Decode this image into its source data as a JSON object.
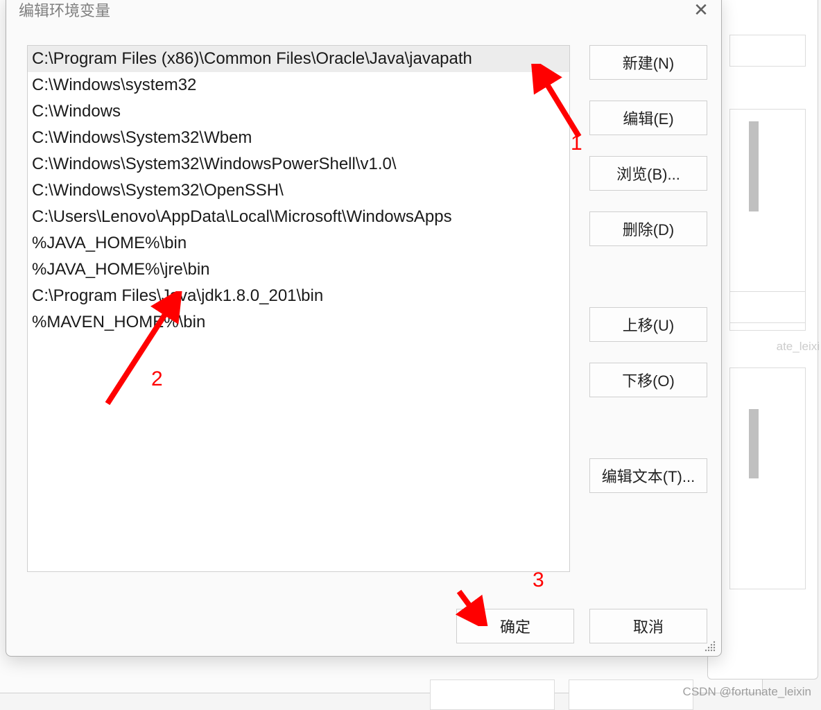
{
  "dialog": {
    "title": "编辑环境变量",
    "list_items": [
      "C:\\Program Files (x86)\\Common Files\\Oracle\\Java\\javapath",
      "C:\\Windows\\system32",
      "C:\\Windows",
      "C:\\Windows\\System32\\Wbem",
      "C:\\Windows\\System32\\WindowsPowerShell\\v1.0\\",
      "C:\\Windows\\System32\\OpenSSH\\",
      "C:\\Users\\Lenovo\\AppData\\Local\\Microsoft\\WindowsApps",
      "%JAVA_HOME%\\bin",
      "%JAVA_HOME%\\jre\\bin",
      "C:\\Program Files\\Java\\jdk1.8.0_201\\bin",
      "%MAVEN_HOME%\\bin"
    ],
    "selected_index": 0,
    "buttons": {
      "new": "新建(N)",
      "edit": "编辑(E)",
      "browse": "浏览(B)...",
      "delete": "删除(D)",
      "move_up": "上移(U)",
      "move_down": "下移(O)",
      "edit_text": "编辑文本(T)...",
      "ok": "确定",
      "cancel": "取消"
    }
  },
  "annotations": {
    "label1": "1",
    "label2": "2",
    "label3": "3"
  },
  "watermark": "CSDN @fortunate_leixin",
  "bg_watermark": "ate_leixi"
}
